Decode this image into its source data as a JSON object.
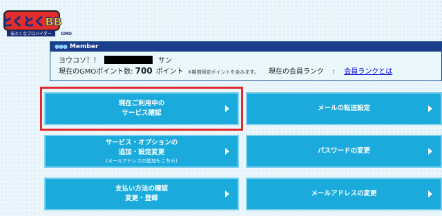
{
  "logo": {
    "main": "とくとくBB",
    "tagline": "安とくなプロバイダー",
    "brand": "GMO"
  },
  "member": {
    "header": "Member",
    "greeting_prefix": "ヨウコソ！！",
    "greeting_suffix": "サン",
    "points_label": "現在のGMOポイント数:",
    "points_value": "700",
    "points_unit": "ポイント",
    "points_note": "※期間限定ポイントを含みます。",
    "rank_label": "現在の会員ランク",
    "rank_sep": ":",
    "rank_link": "会員ランクとは"
  },
  "buttons": [
    {
      "line1": "現在ご利用中の",
      "line2": "サービス確認"
    },
    {
      "line1": "メールの転送設定"
    },
    {
      "line1": "サービス・オプションの",
      "line2": "追加・設定変更",
      "line3": "(メールアドレスの追加もこちら)"
    },
    {
      "line1": "パスワードの変更"
    },
    {
      "line1": "支払い方法の確認",
      "line2": "変更・登録"
    },
    {
      "line1": "メールアドレスの変更"
    }
  ],
  "colors": {
    "button": "#1aabdc",
    "highlight": "#e12a2a",
    "header": "#1b3f8c"
  }
}
